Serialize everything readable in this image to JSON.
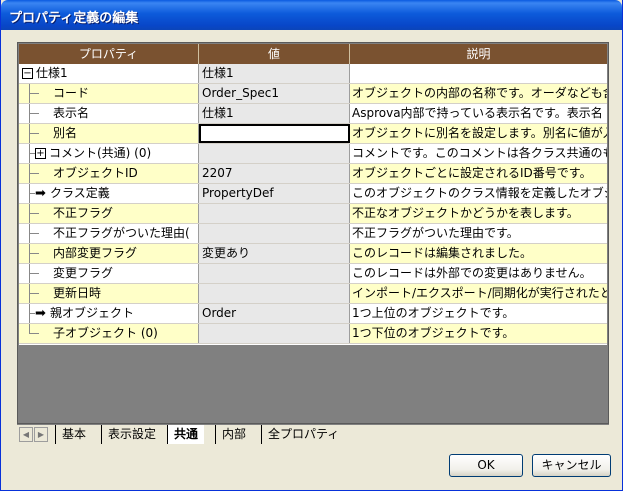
{
  "window": {
    "title": "プロパティ定義の編集"
  },
  "grid": {
    "columns": [
      "プロパティ",
      "値",
      "説明"
    ],
    "rows": [
      {
        "name": "仕様1",
        "value": "仕様1",
        "desc": "",
        "level": 0,
        "expander": "−"
      },
      {
        "name": "コード",
        "value": "Order_Spec1",
        "desc": "オブジェクトの内部の名称です。オーダなども含",
        "level": 1
      },
      {
        "name": "表示名",
        "value": "仕様1",
        "desc": "Asprova内部で持っている表示名です。表示名",
        "level": 1
      },
      {
        "name": "別名",
        "value": "",
        "desc": "オブジェクトに別名を設定します。別名に値が入",
        "level": 1,
        "editing": true
      },
      {
        "name": "コメント(共通) (0)",
        "value": "",
        "desc": "コメントです。このコメントは各クラス共通のもの",
        "level": 1,
        "expander": "+"
      },
      {
        "name": "オブジェクトID",
        "value": "2207",
        "desc": "オブジェクトごとに設定されるID番号です。",
        "level": 1
      },
      {
        "name": "クラス定義",
        "value": "PropertyDef",
        "desc": "このオブジェクトのクラス情報を定義したオブジェ",
        "level": 1,
        "arrow": true
      },
      {
        "name": "不正フラグ",
        "value": "",
        "desc": "不正なオブジェクトかどうかを表します。",
        "level": 1
      },
      {
        "name": "不正フラグがついた理由(",
        "value": "",
        "desc": "不正フラグがついた理由です。",
        "level": 1
      },
      {
        "name": "内部変更フラグ",
        "value": "変更あり",
        "desc": "このレコードは編集されました。",
        "level": 1
      },
      {
        "name": "変更フラグ",
        "value": "",
        "desc": "このレコードは外部での変更はありません。",
        "level": 1
      },
      {
        "name": "更新日時",
        "value": "",
        "desc": "インポート/エクスポート/同期化が実行されたと",
        "level": 1
      },
      {
        "name": "親オブジェクト",
        "value": "Order",
        "desc": "1つ上位のオブジェクトです。",
        "level": 1,
        "arrow": true
      },
      {
        "name": "子オブジェクト (0)",
        "value": "",
        "desc": "1つ下位のオブジェクトです。",
        "level": 1,
        "last": true
      }
    ]
  },
  "tabs": [
    {
      "label": "基本",
      "active": false
    },
    {
      "label": "表示設定",
      "active": false
    },
    {
      "label": "共通",
      "active": true
    },
    {
      "label": "内部",
      "active": false
    },
    {
      "label": "全プロパティ",
      "active": false
    }
  ],
  "buttons": {
    "ok": "OK",
    "cancel": "キャンセル"
  },
  "icons": {
    "collapse": "minus-box-icon",
    "expand": "plus-box-icon",
    "link": "right-arrow-icon",
    "scroll_left": "triangle-left-icon",
    "scroll_right": "triangle-right-icon"
  },
  "colors": {
    "header_bg": "#7a5230",
    "alt_row": "#ffffc8",
    "title_bar": "#0d5bdb"
  }
}
